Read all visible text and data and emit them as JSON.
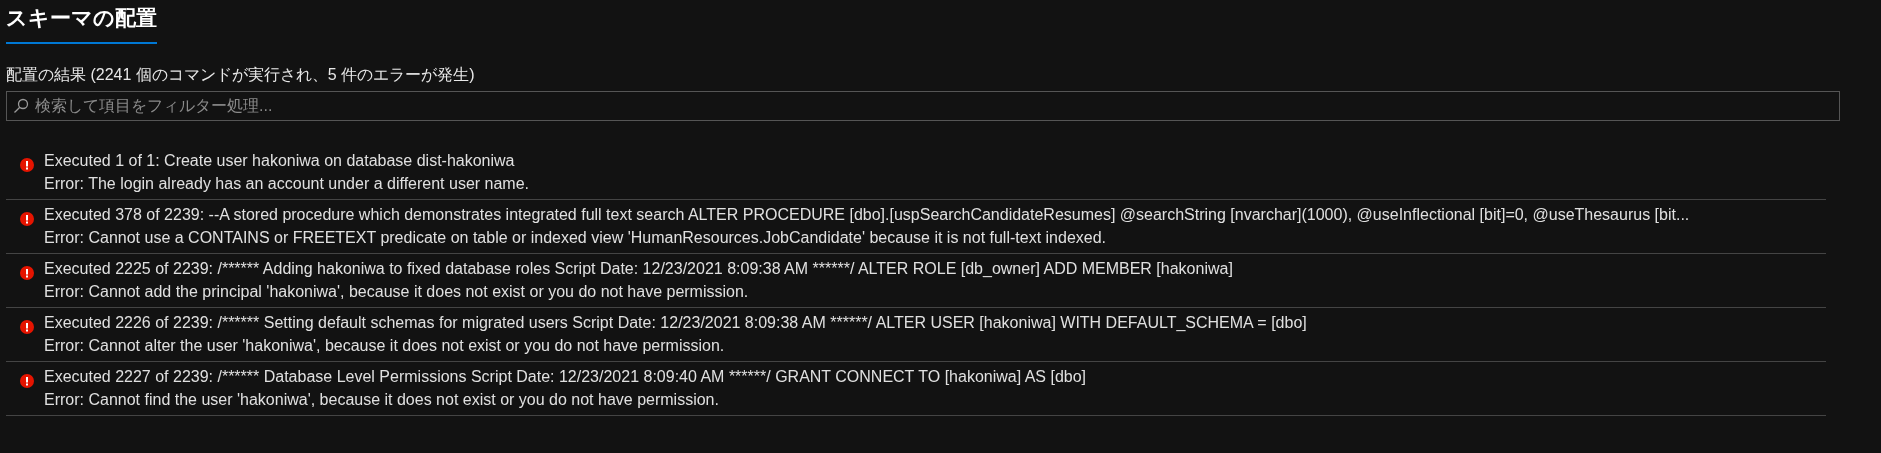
{
  "tabs": [
    {
      "label": "スキーマの配置",
      "selected": true
    }
  ],
  "summary": "配置の結果 (2241 個のコマンドが実行され、5 件のエラーが発生)",
  "search": {
    "placeholder": "検索して項目をフィルター処理..."
  },
  "results": [
    {
      "kind": "error",
      "title": "Executed 1 of 1: Create user hakoniwa on database dist-hakoniwa",
      "message": "Error: The login already has an account under a different user name."
    },
    {
      "kind": "error",
      "title": "Executed 378 of 2239: --A stored procedure which demonstrates integrated full text search ALTER PROCEDURE [dbo].[uspSearchCandidateResumes] @searchString [nvarchar](1000), @useInflectional [bit]=0, @useThesaurus [bit...",
      "message": "Error: Cannot use a CONTAINS or FREETEXT predicate on table or indexed view 'HumanResources.JobCandidate' because it is not full-text indexed."
    },
    {
      "kind": "error",
      "title": "Executed 2225 of 2239: /****** Adding hakoniwa to fixed database roles Script Date: 12/23/2021 8:09:38 AM ******/ ALTER ROLE [db_owner] ADD MEMBER [hakoniwa]",
      "message": "Error: Cannot add the principal 'hakoniwa', because it does not exist or you do not have permission."
    },
    {
      "kind": "error",
      "title": "Executed 2226 of 2239: /****** Setting default schemas for migrated users Script Date: 12/23/2021 8:09:38 AM ******/ ALTER USER [hakoniwa] WITH DEFAULT_SCHEMA = [dbo]",
      "message": "Error: Cannot alter the user 'hakoniwa', because it does not exist or you do not have permission."
    },
    {
      "kind": "error",
      "title": "Executed 2227 of 2239: /****** Database Level Permissions Script Date: 12/23/2021 8:09:40 AM ******/ GRANT CONNECT TO [hakoniwa] AS [dbo]",
      "message": "Error: Cannot find the user 'hakoniwa', because it does not exist or you do not have permission."
    }
  ]
}
